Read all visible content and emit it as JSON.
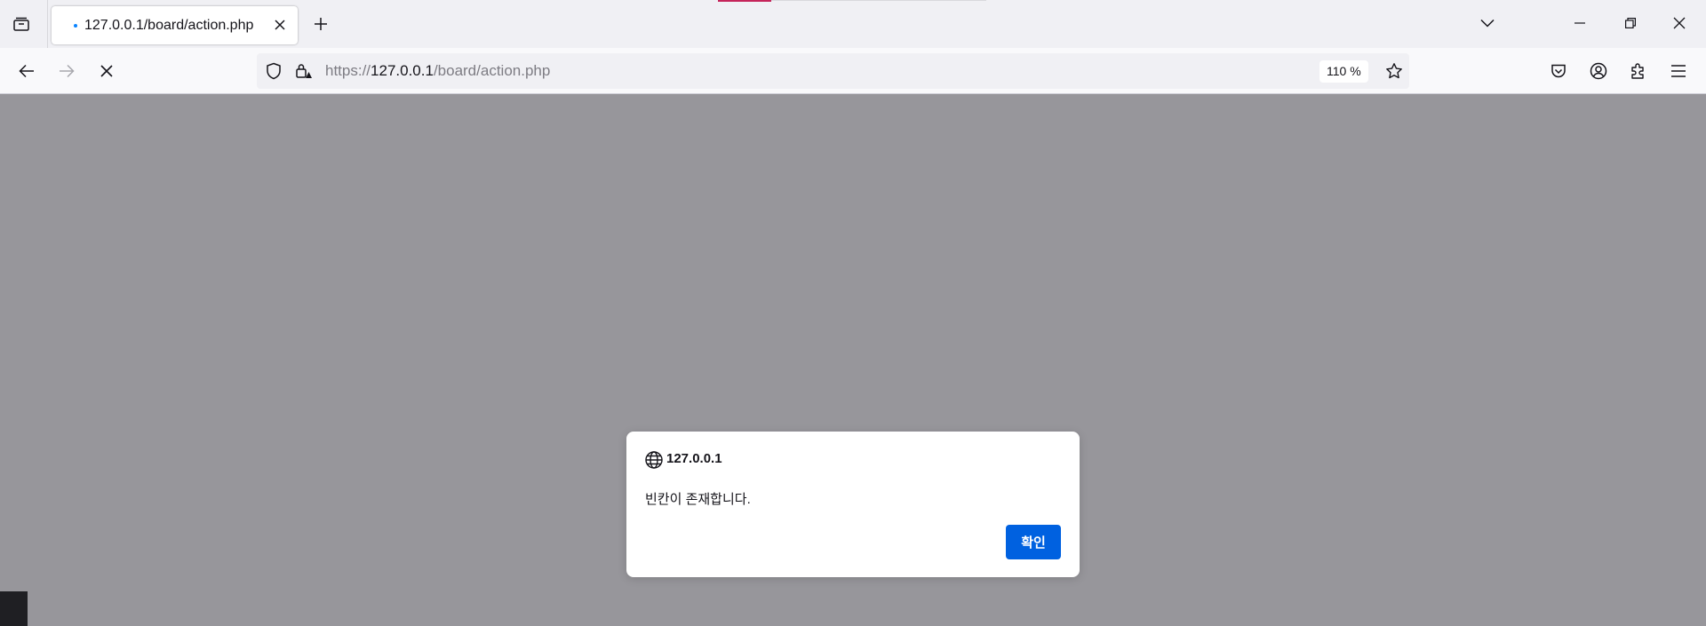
{
  "browser": {
    "tab": {
      "title": "127.0.0.1/board/action.php"
    },
    "url": {
      "scheme": "https://",
      "host": "127.0.0.1",
      "path": "/board/action.php"
    },
    "zoom": "110 %"
  },
  "icons": {
    "tab_list": "tab-list-icon",
    "new_tab": "plus-icon",
    "list_all_tabs": "chevron-down-icon",
    "minimize": "minimize-icon",
    "restore": "restore-icon",
    "close": "close-icon",
    "back": "back-arrow-icon",
    "forward": "forward-arrow-icon",
    "stop": "stop-icon",
    "tracking": "shield-icon",
    "site_info": "lock-warning-icon",
    "bookmark": "star-icon",
    "pocket": "pocket-icon",
    "account": "account-icon",
    "extensions": "puzzle-icon",
    "menu": "hamburger-menu-icon",
    "dialog_origin": "globe-icon"
  },
  "colors": {
    "accent": "#0061e0",
    "loading_dot": "#0a84ff",
    "overlay": "#97969b"
  },
  "dialog": {
    "origin": "127.0.0.1",
    "message": "빈칸이 존재합니다.",
    "ok_label": "확인"
  }
}
